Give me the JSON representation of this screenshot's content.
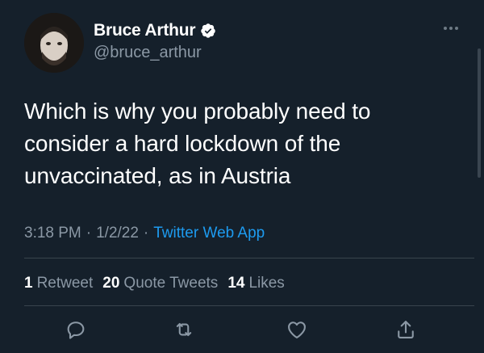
{
  "author": {
    "display_name": "Bruce Arthur",
    "handle": "@bruce_arthur",
    "verified": true
  },
  "tweet": {
    "text": "Which is why you probably need to\nconsider a hard lockdown of the\nunvaccinated, as in Austria",
    "time": "3:18 PM",
    "date": "1/2/22",
    "source": "Twitter Web App",
    "separator": "·"
  },
  "stats": {
    "retweets": {
      "count": "1",
      "label": "Retweet"
    },
    "quotes": {
      "count": "20",
      "label": "Quote Tweets"
    },
    "likes": {
      "count": "14",
      "label": "Likes"
    }
  },
  "actions": {
    "reply_icon": "reply-icon",
    "retweet_icon": "retweet-icon",
    "like_icon": "heart-icon",
    "share_icon": "share-icon"
  },
  "colors": {
    "background": "#15202b",
    "secondary_text": "#8b98a5",
    "link": "#1d9bf0",
    "verified": "#ffffff"
  }
}
